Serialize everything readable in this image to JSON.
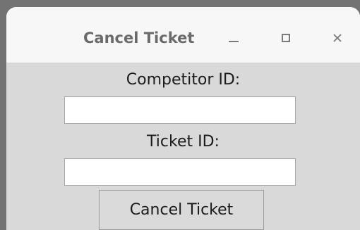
{
  "window": {
    "title": "Cancel Ticket",
    "controls": {
      "minimize_icon": "minimize-icon",
      "maximize_icon": "maximize-icon",
      "close_icon": "close-icon",
      "close_glyph": "×"
    }
  },
  "form": {
    "competitor_label": "Competitor ID:",
    "competitor_value": "",
    "ticket_label": "Ticket ID:",
    "ticket_value": "",
    "submit_label": "Cancel Ticket"
  },
  "colors": {
    "titlebar": "#f7f7f7",
    "body": "#d9d9d9",
    "desktop": "#737373",
    "title_text": "#6a6a6a"
  }
}
